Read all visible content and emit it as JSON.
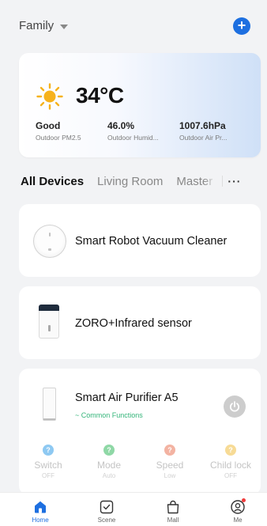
{
  "header": {
    "home_name": "Family"
  },
  "weather": {
    "temperature": "34°C",
    "metrics": [
      {
        "value": "Good",
        "label": "Outdoor PM2.5"
      },
      {
        "value": "46.0%",
        "label": "Outdoor Humid..."
      },
      {
        "value": "1007.6hPa",
        "label": "Outdoor Air Pr..."
      }
    ]
  },
  "tabs": [
    {
      "label": "All Devices",
      "active": true
    },
    {
      "label": "Living Room",
      "active": false
    },
    {
      "label": "Master Bedroom",
      "active": false
    }
  ],
  "devices": [
    {
      "name": "Smart Robot Vacuum Cleaner",
      "icon": "robot-vacuum-icon"
    },
    {
      "name": "ZORO+Infrared sensor",
      "icon": "infrared-sensor-icon"
    },
    {
      "name": "Smart Air Purifier A5",
      "icon": "air-purifier-icon",
      "sub": "~ Common Functions"
    }
  ],
  "controls": [
    {
      "name": "Switch",
      "state": "OFF",
      "color": "#8ec9f2"
    },
    {
      "name": "Mode",
      "state": "Auto",
      "color": "#8fd8a6"
    },
    {
      "name": "Speed",
      "state": "Low",
      "color": "#f3b3a2"
    },
    {
      "name": "Child lock",
      "state": "OFF",
      "color": "#f7db96"
    }
  ],
  "nav": [
    {
      "label": "Home",
      "icon": "home-icon"
    },
    {
      "label": "Scene",
      "icon": "scene-icon"
    },
    {
      "label": "Mall",
      "icon": "shopping-bag-icon"
    },
    {
      "label": "Me",
      "icon": "profile-icon"
    }
  ],
  "colors": {
    "accent": "#1d6fe0",
    "common_functions": "#35b57a"
  }
}
